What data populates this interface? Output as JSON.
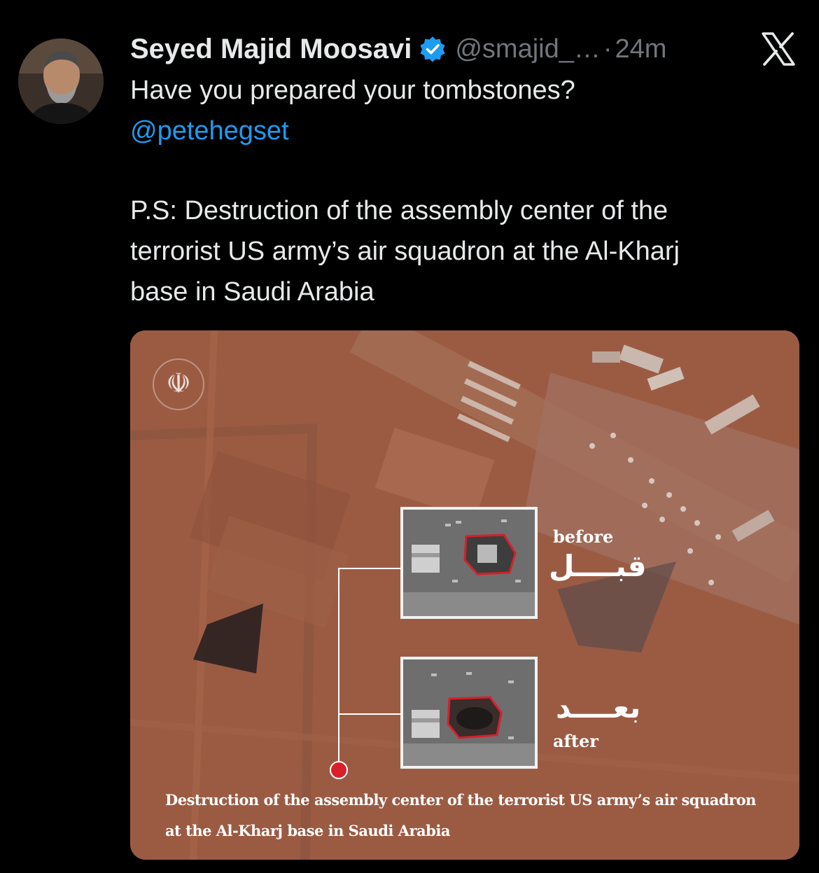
{
  "tweet": {
    "author_name": "Seyed Majid Moosavi",
    "handle": "@smajid_…",
    "separator": "·",
    "time": "24m",
    "line1": "Have you prepared your tombstones?",
    "mention": "@petehegset",
    "ps_lines": [
      "P.S: Destruction of the assembly center of the",
      "terrorist US army’s air squadron at the Al-Kharj",
      "base in Saudi Arabia"
    ]
  },
  "icons": {
    "verified": "verified-badge-icon",
    "platform": "x-logo-icon",
    "emblem": "iran-emblem-icon"
  },
  "colors": {
    "background": "#000000",
    "text": "#e7e9ea",
    "muted": "#71767b",
    "link": "#1d9bf0",
    "verified": "#1d9bf0",
    "marker_red": "#d81f2a"
  },
  "media": {
    "emblem_glyph": "☫",
    "before_en": "before",
    "before_ar": "قبــــل",
    "after_en": "after",
    "after_ar": "بعــــد",
    "caption_lines": [
      "Destruction of the assembly center of the terrorist US army’s air squadron",
      "at the Al-Kharj base in Saudi Arabia"
    ]
  }
}
